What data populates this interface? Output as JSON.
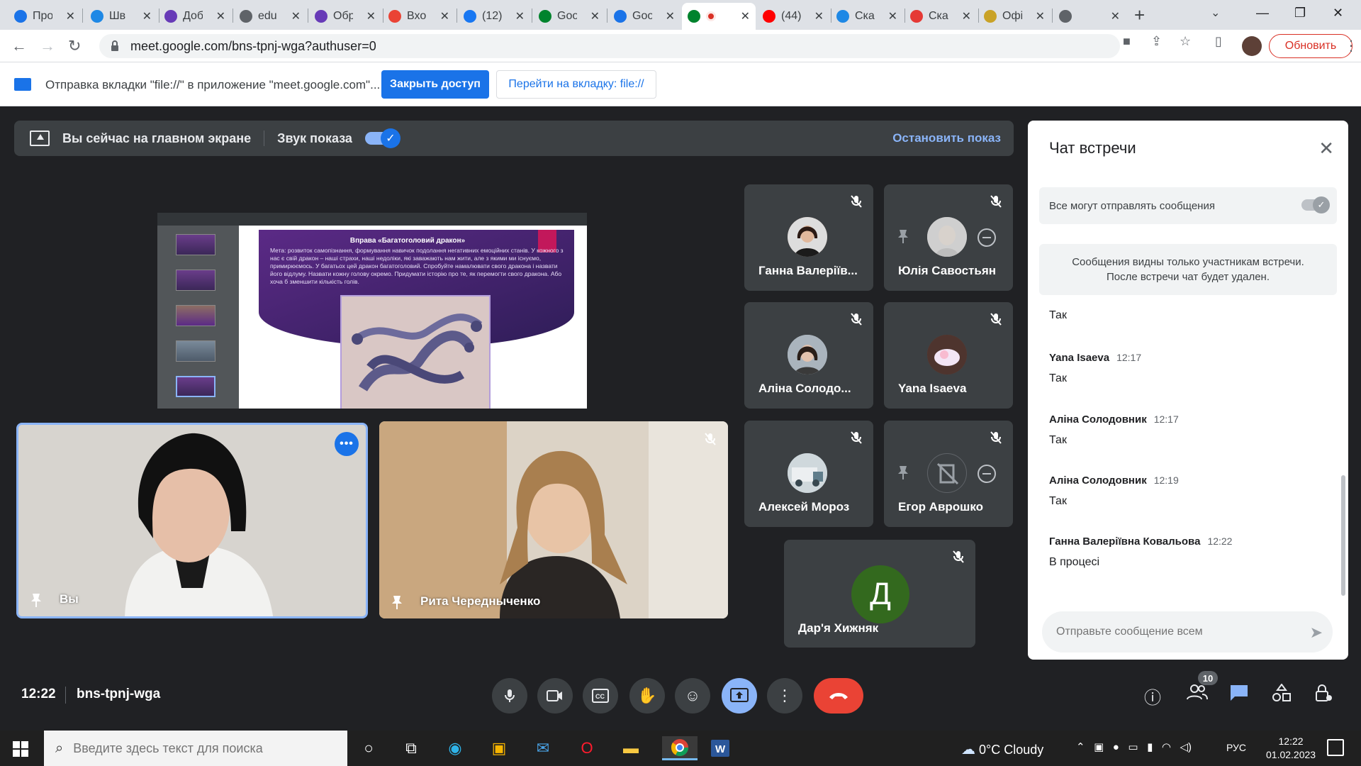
{
  "browser": {
    "tabs": [
      {
        "title": "Про",
        "icon": "chrome-icon",
        "color": "#1a73e8"
      },
      {
        "title": "Шв",
        "icon": "edge-icon",
        "color": "#1e88e5"
      },
      {
        "title": "Доб",
        "icon": "shield-icon",
        "color": "#673ab7"
      },
      {
        "title": "edu",
        "icon": "globe-icon",
        "color": "#5f6368"
      },
      {
        "title": "Обр",
        "icon": "shield-icon",
        "color": "#673ab7"
      },
      {
        "title": "Вхо",
        "icon": "gmail-icon",
        "color": "#ea4335"
      },
      {
        "title": "(12)",
        "icon": "facebook-icon",
        "color": "#1877f2"
      },
      {
        "title": "Goo",
        "icon": "meet-icon",
        "color": "#00832d"
      },
      {
        "title": "Goo",
        "icon": "classroom-icon",
        "color": "#1a73e8"
      },
      {
        "title": "",
        "icon": "meet-icon",
        "color": "#00832d",
        "active": true
      },
      {
        "title": "(44)",
        "icon": "youtube-icon",
        "color": "#ff0000"
      },
      {
        "title": "Ска",
        "icon": "heart-icon",
        "color": "#1e88e5"
      },
      {
        "title": "Ска",
        "icon": "heart-icon",
        "color": "#e53935"
      },
      {
        "title": "Офі",
        "icon": "crest-icon",
        "color": "#c9a227"
      },
      {
        "title": "",
        "icon": "globe-icon",
        "color": "#5f6368"
      }
    ],
    "url": "meet.google.com/bns-tpnj-wga?authuser=0",
    "update_label": "Обновить",
    "infobar": {
      "text": "Отправка вкладки \"file://\" в приложение \"meet.google.com\"...",
      "stop_label": "Закрыть доступ",
      "switch_label": "Перейти на вкладку: file://"
    }
  },
  "meet": {
    "present_bar": {
      "text": "Вы сейчас на главном экране",
      "audio_label": "Звук показа",
      "audio_on": true,
      "stop_label": "Остановить показ"
    },
    "shared_screen": {
      "title": "Вправа «Багатоголовий дракон»",
      "body": "Мета: розвиток самопізнання, формування навичок подолання негативних емоційних станів. У кожного з нас є свій дракон – наші страхи, наші недоліки, які заважають нам жити, але з якими ми існуємо, примирюємось. У багатьох цей дракон багатоголовий. Спробуйте намалювати свого дракона і назвати його відлуму. Назвати кожну голову окремо. Придумати історію про те, як перемогти свого дракона. Або хоча б зменшити кількість голів."
    },
    "self_tile": {
      "name": "Вы"
    },
    "rita_tile": {
      "name": "Рита Чередныченко"
    },
    "participants": [
      {
        "name": "Ганна Валеріїв...",
        "avatar": "photo"
      },
      {
        "name": "Юлія Савостьян",
        "avatar": "photo"
      },
      {
        "name": "Аліна Солодо...",
        "avatar": "photo"
      },
      {
        "name": "Yana Isaeva",
        "avatar": "photo"
      },
      {
        "name": "Алексей Мороз",
        "avatar": "photo"
      },
      {
        "name": "Егор Аврошко",
        "avatar": "photo"
      }
    ],
    "daria": {
      "name": "Дар'я Хижняк",
      "initial": "Д",
      "color": "#33691e"
    },
    "chat": {
      "title": "Чат встречи",
      "allow_text": "Все могут отправлять сообщения",
      "notice_line1": "Сообщения видны только участникам встречи.",
      "notice_line2": "После встречи чат будет удален.",
      "messages": [
        {
          "sender": "",
          "time": "",
          "text": "Так"
        },
        {
          "sender": "Yana Isaeva",
          "time": "12:17",
          "text": "Так"
        },
        {
          "sender": "Аліна Солодовник",
          "time": "12:17",
          "text": "Так"
        },
        {
          "sender": "Аліна Солодовник",
          "time": "12:19",
          "text": "Так"
        },
        {
          "sender": "Ганна Валеріївна Ковальова",
          "time": "12:22",
          "text": "В процесі"
        }
      ],
      "input_placeholder": "Отправьте сообщение всем"
    },
    "bottom": {
      "time": "12:22",
      "code": "bns-tpnj-wga",
      "people_count": "10"
    }
  },
  "taskbar": {
    "search_placeholder": "Введите здесь текст для поиска",
    "weather": "0°C  Cloudy",
    "lang": "РУС",
    "time": "12:22",
    "date": "01.02.2023"
  }
}
